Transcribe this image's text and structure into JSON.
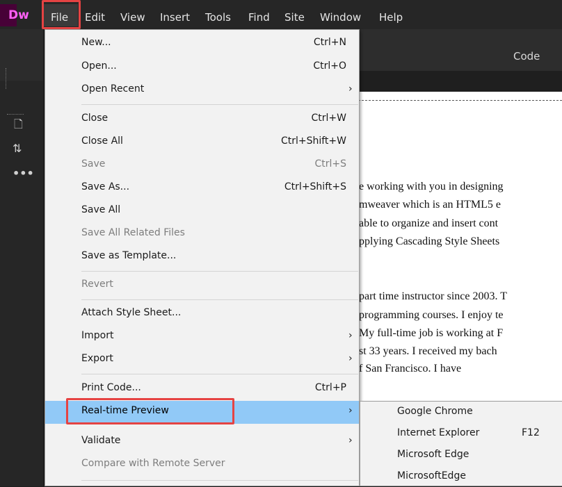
{
  "app": {
    "logo": "Dw"
  },
  "menubar": [
    "File",
    "Edit",
    "View",
    "Insert",
    "Tools",
    "Find",
    "Site",
    "Window",
    "Help"
  ],
  "toolbar": {
    "code_label": "Code"
  },
  "file_menu": [
    {
      "label": "New...",
      "shortcut": "Ctrl+N"
    },
    {
      "label": "Open...",
      "shortcut": "Ctrl+O"
    },
    {
      "label": "Open Recent",
      "submenu": true
    },
    {
      "label": "Close",
      "shortcut": "Ctrl+W"
    },
    {
      "label": "Close All",
      "shortcut": "Ctrl+Shift+W"
    },
    {
      "label": "Save",
      "shortcut": "Ctrl+S",
      "disabled": true
    },
    {
      "label": "Save As...",
      "shortcut": "Ctrl+Shift+S"
    },
    {
      "label": "Save All"
    },
    {
      "label": "Save All Related Files",
      "disabled": true
    },
    {
      "label": "Save as Template..."
    },
    {
      "label": "Revert",
      "disabled": true
    },
    {
      "label": "Attach Style Sheet..."
    },
    {
      "label": "Import",
      "submenu": true
    },
    {
      "label": "Export",
      "submenu": true
    },
    {
      "label": "Print Code...",
      "shortcut": "Ctrl+P"
    },
    {
      "label": "Real-time Preview",
      "submenu": true,
      "highlighted": true
    },
    {
      "label": "Validate",
      "submenu": true
    },
    {
      "label": "Compare with Remote Server",
      "disabled": true
    }
  ],
  "realtime_preview_submenu": [
    {
      "label": "Google Chrome",
      "shortcut": ""
    },
    {
      "label": "Internet Explorer",
      "shortcut": "F12"
    },
    {
      "label": "Microsoft Edge",
      "shortcut": ""
    },
    {
      "label": "MicrosoftEdge",
      "shortcut": ""
    }
  ],
  "document_text": [
    "e working with you in designing",
    "mweaver which is an HTML5 e",
    " able to organize and insert cont",
    "pplying Cascading Style Sheets",
    "part time instructor since 2003. T",
    "programming courses. I enjoy te",
    " My full-time job is working at F",
    "st 33 years. I received my bach",
    "f San Francisco. I have"
  ],
  "tool_icons": [
    "file-icon",
    "sort-icon",
    "more-icon"
  ],
  "colors": {
    "menu_highlight": "#91c9f7",
    "annotation_red": "#e54343",
    "brand": "#ff61f6"
  }
}
